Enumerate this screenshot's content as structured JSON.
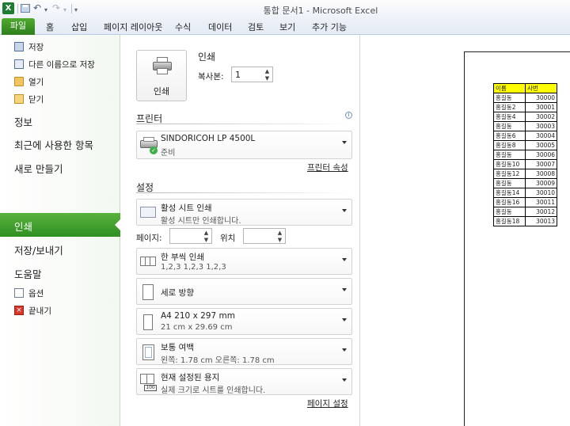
{
  "window": {
    "app_logo_letter": "X",
    "title": "통합 문서1  -  Microsoft Excel"
  },
  "quick_access": {
    "undo_glyph": "↶",
    "redo_glyph": "↷",
    "customize_glyph": "▾"
  },
  "ribbon_tabs": {
    "file": "파일",
    "items": [
      "홈",
      "삽입",
      "페이지 레이아웃",
      "수식",
      "데이터",
      "검토",
      "보기",
      "추가 기능"
    ]
  },
  "backstage_nav": {
    "save": "저장",
    "save_as": "다른 이름으로 저장",
    "open": "열기",
    "close": "닫기",
    "info": "정보",
    "recent": "최근에 사용한 항목",
    "new": "새로 만들기",
    "print": "인쇄",
    "save_send": "저장/보내기",
    "help": "도움말",
    "options": "옵션",
    "exit": "끝내기"
  },
  "print_panel": {
    "print_button": "인쇄",
    "print_heading": "인쇄",
    "copies_label": "복사본:",
    "copies_value": "1",
    "printer_heading": "프린터",
    "printer_name": "SINDORICOH LP 4500L",
    "printer_status": "준비",
    "printer_properties": "프린터 속성",
    "settings_heading": "설정",
    "print_what": {
      "title": "활성 시트 인쇄",
      "sub": "활성 시트만 인쇄합니다."
    },
    "pages_label": "페이지:",
    "pages_to_label": "위치",
    "collate": {
      "title": "한 부씩 인쇄",
      "sub": "1,2,3    1,2,3    1,2,3"
    },
    "orientation": {
      "title": "세로 방향"
    },
    "paper": {
      "title": "A4 210 x 297 mm",
      "sub": "21 cm x 29.69 cm"
    },
    "margins": {
      "title": "보통 여백",
      "sub": "왼쪽:  1.78 cm    오른쪽:  1.78 cm"
    },
    "scaling": {
      "title": "현재 설정된 용지",
      "sub": "실제 크기로 시트를 인쇄합니다.",
      "icon_text": "100"
    },
    "page_setup": "페이지 설정"
  },
  "preview_sheet": {
    "headers": [
      "이름",
      "사번"
    ],
    "rows": [
      [
        "홍길동",
        "30000"
      ],
      [
        "홍길동2",
        "30001"
      ],
      [
        "홍길동4",
        "30002"
      ],
      [
        "홍길동",
        "30003"
      ],
      [
        "홍길동6",
        "30004"
      ],
      [
        "홍길동8",
        "30005"
      ],
      [
        "홍길동",
        "30006"
      ],
      [
        "홍길동10",
        "30007"
      ],
      [
        "홍길동12",
        "30008"
      ],
      [
        "홍길동",
        "30009"
      ],
      [
        "홍길동14",
        "30010"
      ],
      [
        "홍길동16",
        "30011"
      ],
      [
        "홍길동",
        "30012"
      ],
      [
        "홍길동18",
        "30013"
      ]
    ],
    "header_color": "#ffff00"
  },
  "colors": {
    "file_tab": "#3a8f23",
    "nav_active": "#4aa634"
  }
}
